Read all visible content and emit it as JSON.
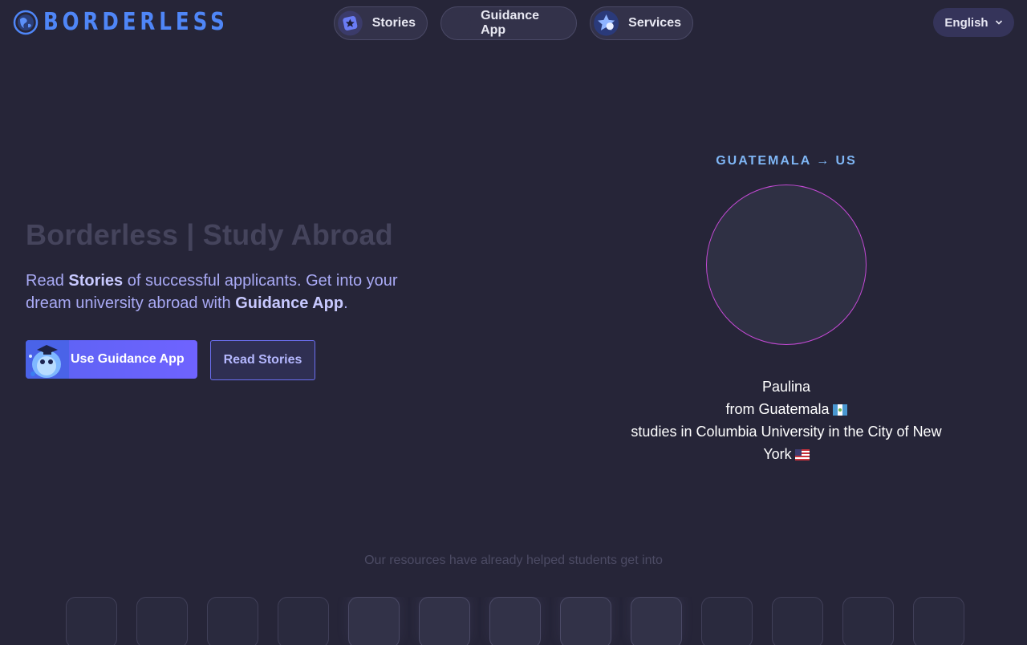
{
  "brand": {
    "name": "BORDERLESS"
  },
  "nav": {
    "items": [
      {
        "label": "Stories",
        "icon": "stories-star-icon"
      },
      {
        "label": "Guidance App",
        "icon": "guidance-app-icon"
      },
      {
        "label": "Services",
        "icon": "services-star-icon"
      }
    ]
  },
  "language": {
    "selected": "English",
    "icon": "chevron-down-icon"
  },
  "hero": {
    "title": "Borderless | Study Abroad",
    "subtitle": {
      "part1": "Read ",
      "stories": "Stories",
      "part2": " of successful applicants. Get into your dream university abroad with ",
      "guidance": "Guidance App",
      "part3": "."
    },
    "primary_button": "Use Guidance App",
    "secondary_button": "Read Stories"
  },
  "story": {
    "route": "GUATEMALA → US",
    "name": "Paulina",
    "from": "from Guatemala",
    "studies": "studies in Columbia University in the City of New York",
    "colors": {
      "ring": "#c54ad6"
    }
  },
  "resources": {
    "text": "Our resources have already helped students get into",
    "tile_count": 13
  },
  "colors": {
    "background": "#262538",
    "accent": "#4f86f7",
    "primary_button": "#5b63f2",
    "subtitle": "#a9aaf5"
  }
}
